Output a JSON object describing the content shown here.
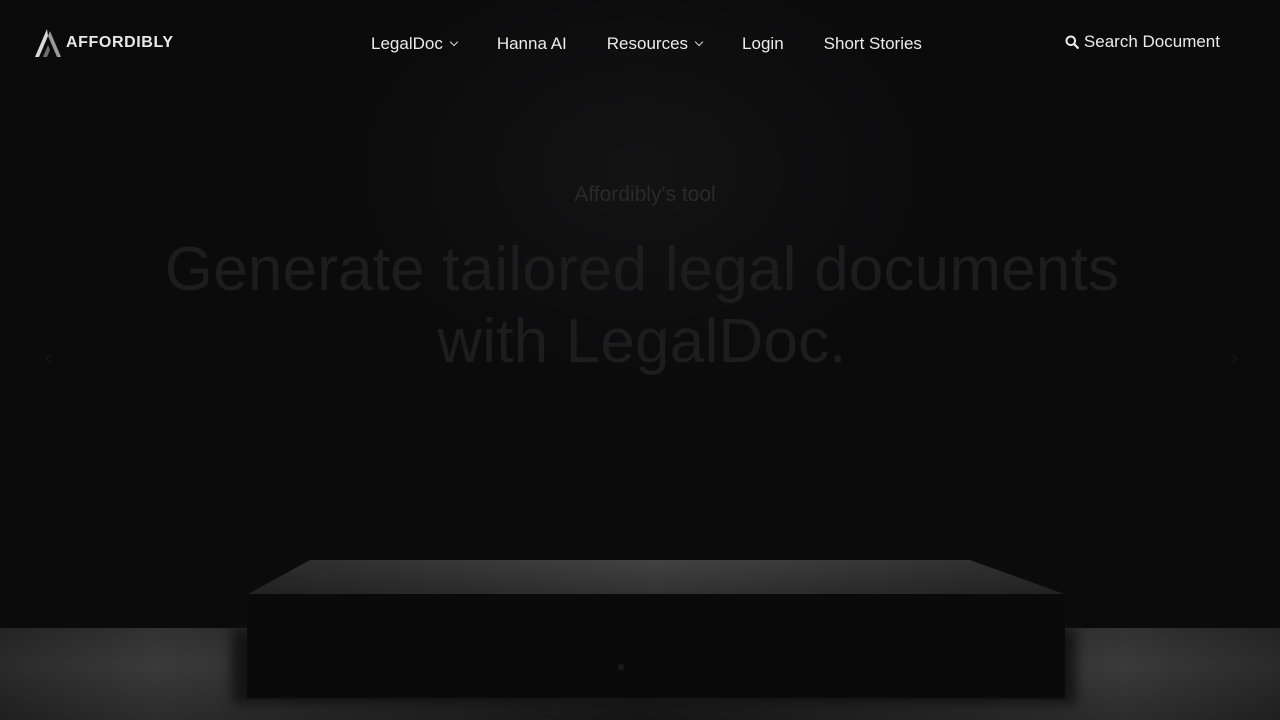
{
  "brand": {
    "name": "AFFORDIBLY",
    "logo_icon": "affordibly-logo-icon"
  },
  "nav": {
    "items": [
      {
        "label": "LegalDoc",
        "has_dropdown": true
      },
      {
        "label": "Hanna AI",
        "has_dropdown": false
      },
      {
        "label": "Resources",
        "has_dropdown": true
      },
      {
        "label": "Login",
        "has_dropdown": false
      },
      {
        "label": "Short Stories",
        "has_dropdown": false
      }
    ]
  },
  "search": {
    "label": "Search Document",
    "icon": "search-icon"
  },
  "hero": {
    "eyebrow": "Affordibly's tool",
    "headline_line1": "Generate tailored legal documents",
    "headline_line2": "with LegalDoc."
  },
  "slider": {
    "prev_icon": "chevron-left-icon",
    "next_icon": "chevron-right-icon"
  },
  "colors": {
    "background": "#0b0b0c",
    "nav_text": "#ebebeb",
    "hero_text": "#1d1d1e"
  }
}
